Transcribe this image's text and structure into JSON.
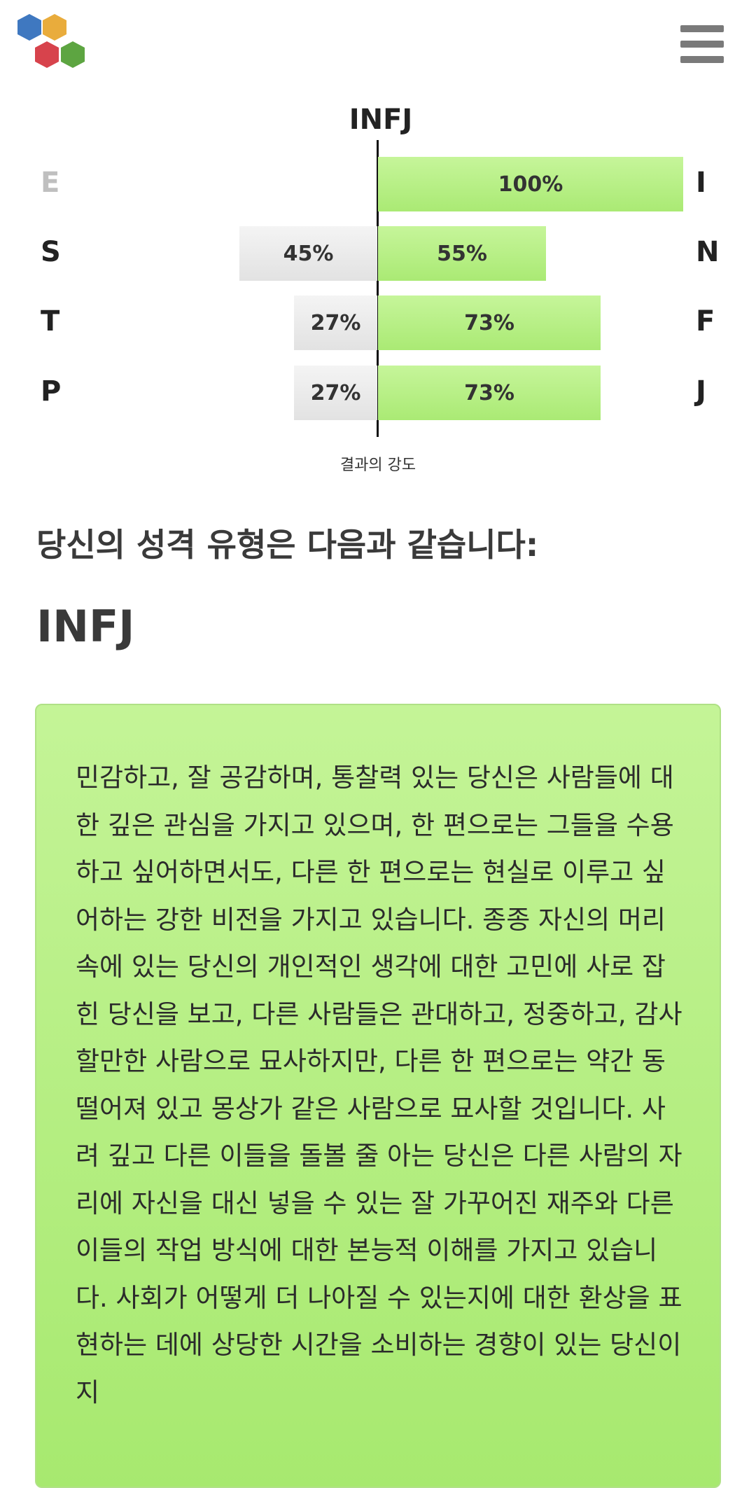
{
  "header": {
    "logo_icon": "hexagon-cluster-logo",
    "menu_icon": "hamburger-menu-icon"
  },
  "result_chart": {
    "type_label": "INFJ",
    "strength_label": "결과의 강도",
    "rows": [
      {
        "left_letter": "E",
        "right_letter": "I",
        "left_percent": "",
        "right_percent": "100%"
      },
      {
        "left_letter": "S",
        "right_letter": "N",
        "left_percent": "45%",
        "right_percent": "55%"
      },
      {
        "left_letter": "T",
        "right_letter": "F",
        "left_percent": "27%",
        "right_percent": "73%"
      },
      {
        "left_letter": "P",
        "right_letter": "J",
        "left_percent": "27%",
        "right_percent": "73%"
      }
    ],
    "colors": {
      "green": "#aaea74",
      "grey": "#e6e6e6",
      "faded_letter": "#bfbfbf"
    }
  },
  "result": {
    "subtitle": "당신의 성격 유형은 다음과 같습니다:",
    "type": "INFJ",
    "description": "민감하고, 잘 공감하며, 통찰력 있는 당신은 사람들에 대한 깊은 관심을 가지고 있으며, 한 편으로는 그들을 수용하고 싶어하면서도, 다른 한 편으로는 현실로 이루고 싶어하는 강한 비전을 가지고 있습니다. 종종 자신의 머리 속에 있는 당신의 개인적인 생각에 대한 고민에 사로 잡힌 당신을 보고, 다른 사람들은 관대하고, 정중하고, 감사할만한 사람으로 묘사하지만, 다른 한 편으로는 약간 동떨어져 있고 몽상가 같은 사람으로 묘사할 것입니다. 사려 깊고 다른 이들을 돌볼 줄 아는 당신은 다른 사람의 자리에 자신을 대신 넣을 수 있는 잘 가꾸어진 재주와 다른 이들의 작업 방식에 대한 본능적 이해를 가지고 있습니다. 사회가 어떻게 더 나아질 수 있는지에 대한 환상을 표현하는 데에 상당한 시간을 소비하는 경향이 있는 당신이지"
  }
}
